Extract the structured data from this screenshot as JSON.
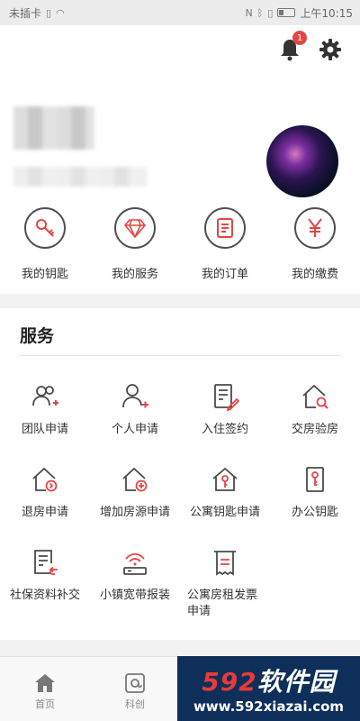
{
  "status_bar": {
    "carrier": "未插卡",
    "time": "上午10:15"
  },
  "header": {
    "notification_count": "1"
  },
  "quick_actions": [
    {
      "label": "我的钥匙",
      "icon": "key-icon"
    },
    {
      "label": "我的服务",
      "icon": "diamond-icon"
    },
    {
      "label": "我的订单",
      "icon": "order-icon"
    },
    {
      "label": "我的缴费",
      "icon": "yen-icon"
    }
  ],
  "services": {
    "title": "服务",
    "items": [
      {
        "label": "团队申请",
        "icon": "team-icon"
      },
      {
        "label": "个人申请",
        "icon": "person-add-icon"
      },
      {
        "label": "入住签约",
        "icon": "sign-contract-icon"
      },
      {
        "label": "交房验房",
        "icon": "house-inspect-icon"
      },
      {
        "label": "退房申请",
        "icon": "house-checkout-icon"
      },
      {
        "label": "增加房源申请",
        "icon": "house-add-icon"
      },
      {
        "label": "公寓钥匙申请",
        "icon": "house-key-icon"
      },
      {
        "label": "办公钥匙",
        "icon": "office-key-icon"
      },
      {
        "label": "社保资料补交",
        "icon": "document-return-icon"
      },
      {
        "label": "小镇宽带报装",
        "icon": "router-icon"
      },
      {
        "label": "公寓房租发票申请",
        "icon": "invoice-icon"
      }
    ]
  },
  "tabbar": {
    "home_label": "首页",
    "innovation_label": "科创"
  },
  "watermark": {
    "brand_number": "592",
    "brand_text": "软件园",
    "url": "www.592xiazai.com"
  },
  "colors": {
    "accent": "#e64545",
    "icon_stroke": "#4a4a4a",
    "badge": "#e64545"
  }
}
